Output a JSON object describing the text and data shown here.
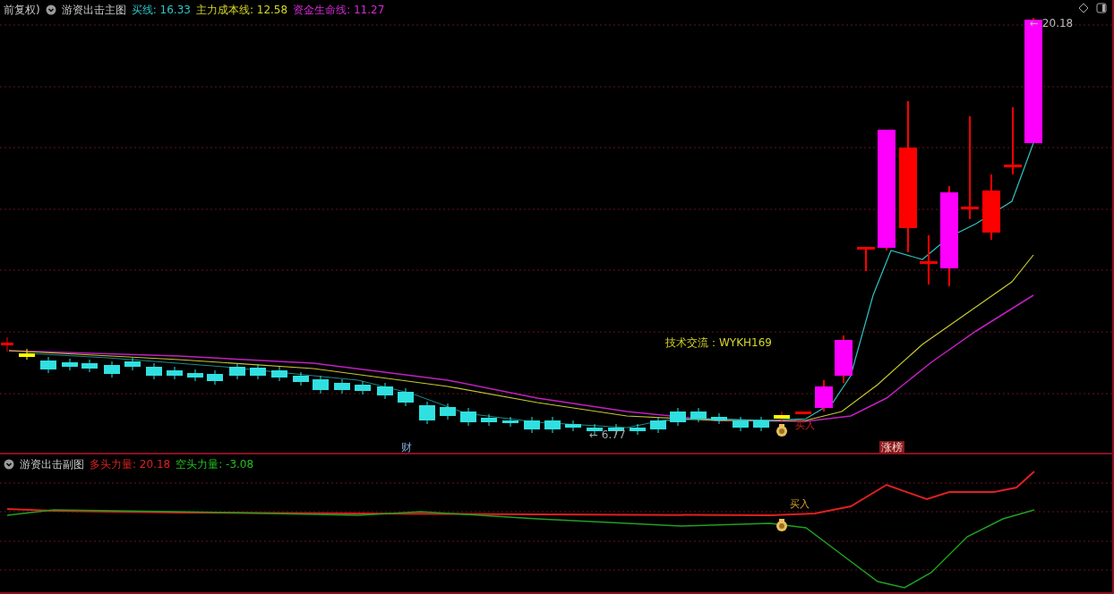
{
  "main_panel": {
    "adjust_label": "前复权)",
    "title": "游资出击主图",
    "indicators": [
      {
        "name": "买线: ",
        "value": "16.33",
        "color": "#2fc6c6"
      },
      {
        "name": "主力成本线: ",
        "value": "12.58",
        "color": "#d6d62a"
      },
      {
        "name": "资金生命线: ",
        "value": "11.27",
        "color": "#d62ad6"
      }
    ],
    "high_label": "← 20.18",
    "low_label": "← 6.77",
    "contact_note": "技术交流：WYKH169",
    "buy_signal": "买入",
    "event_markers": [
      {
        "text": "财",
        "kind": "plain"
      },
      {
        "text": "涨榜",
        "kind": "boxed"
      }
    ]
  },
  "sub_panel": {
    "title": "游资出击副图",
    "indicators": [
      {
        "name": "多头力量: ",
        "value": "20.18",
        "color": "#e02020"
      },
      {
        "name": "空头力量: ",
        "value": "-3.08",
        "color": "#20c020"
      }
    ],
    "buy_signal": "买入"
  }
}
